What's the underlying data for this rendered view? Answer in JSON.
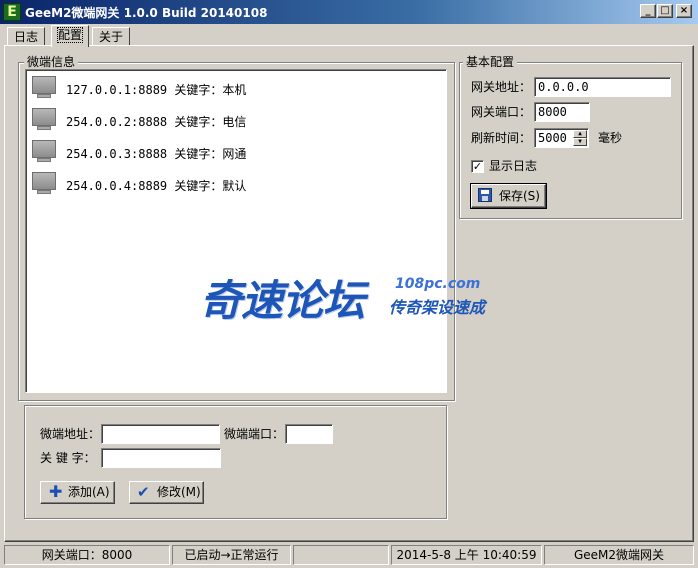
{
  "window": {
    "title": "GeeM2微端网关 1.0.0 Build 20140108",
    "icon_letter": "E",
    "buttons": {
      "minimize": "_",
      "maximize": "□",
      "close": "×"
    }
  },
  "tabs": [
    {
      "label": "日志"
    },
    {
      "label": "配置",
      "active": true
    },
    {
      "label": "关于"
    }
  ],
  "micro_info": {
    "caption": "微端信息",
    "items": [
      {
        "text": "127.0.0.1:8889 关键字：本机"
      },
      {
        "text": "254.0.0.2:8888 关键字：电信"
      },
      {
        "text": "254.0.0.3:8888 关键字：网通"
      },
      {
        "text": "254.0.0.4:8889 关键字：默认"
      }
    ]
  },
  "edit_panel": {
    "address_label": "微端地址：",
    "address_value": "",
    "port_label": "微端端口：",
    "port_value": "",
    "keyword_label": "关 键 字：",
    "keyword_value": "",
    "add_label": "添加(A)",
    "modify_label": "修改(M)"
  },
  "basic_config": {
    "caption": "基本配置",
    "gateway_address_label": "网关地址：",
    "gateway_address_value": "0.0.0.0",
    "gateway_port_label": "网关端口：",
    "gateway_port_value": "8000",
    "refresh_label": "刷新时间：",
    "refresh_value": "5000",
    "refresh_unit": "毫秒",
    "show_log_label": "显示日志",
    "show_log_checked": true,
    "save_label": "保存(S)"
  },
  "watermark": {
    "main": "奇速论坛",
    "url": "108pc.com",
    "sub": "传奇架设速成"
  },
  "status_bar": {
    "port": "网关端口：8000",
    "state": "已启动→正常运行",
    "empty": "",
    "datetime": "2014-5-8 上午 10:40:59",
    "app_name": "GeeM2微端网关"
  }
}
